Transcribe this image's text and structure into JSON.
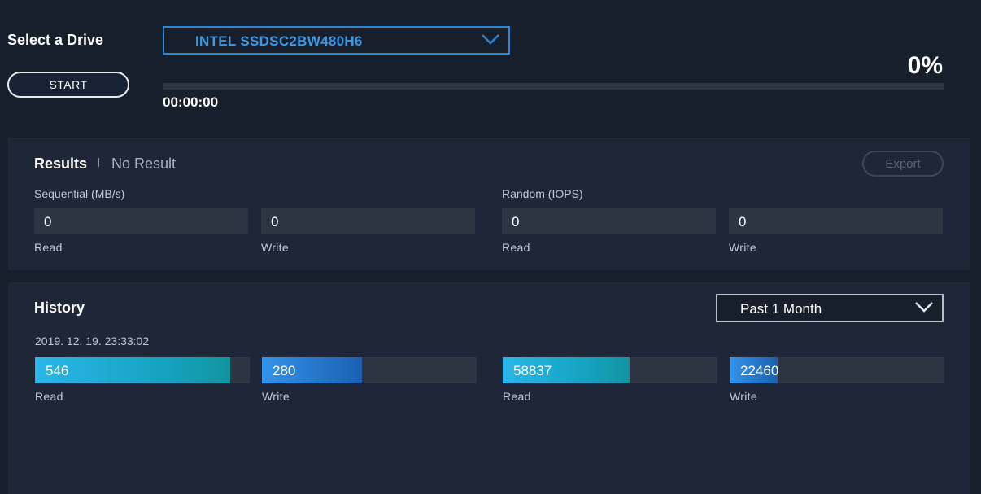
{
  "colors": {
    "background": "#181f2c",
    "panel": "#1f2637",
    "accent": "#2a86d6",
    "teal": "#14a1bd",
    "blue": "#1a5fb0"
  },
  "drive": {
    "label": "Select a Drive",
    "selected": "INTEL SSDSC2BW480H6"
  },
  "start_label": "START",
  "progress": {
    "percent_text": "0%",
    "fraction": 0,
    "elapsed": "00:00:00"
  },
  "results": {
    "title": "Results",
    "separator": "I",
    "status": "No Result",
    "export_label": "Export",
    "sequential": {
      "label": "Sequential (MB/s)",
      "read": "0",
      "write": "0"
    },
    "random": {
      "label": "Random (IOPS)",
      "read": "0",
      "write": "0"
    },
    "read_label": "Read",
    "write_label": "Write"
  },
  "history": {
    "title": "History",
    "period": "Past 1 Month",
    "timestamp": "2019. 12. 19. 23:33:02",
    "seq_read": {
      "value": "546",
      "fraction": 0.91
    },
    "seq_write": {
      "value": "280",
      "fraction": 0.465
    },
    "rand_read": {
      "value": "58837",
      "fraction": 0.59
    },
    "rand_write": {
      "value": "22460",
      "fraction": 0.225
    },
    "read_label": "Read",
    "write_label": "Write"
  },
  "icons": {
    "dropdown": "chevron-down-icon"
  }
}
